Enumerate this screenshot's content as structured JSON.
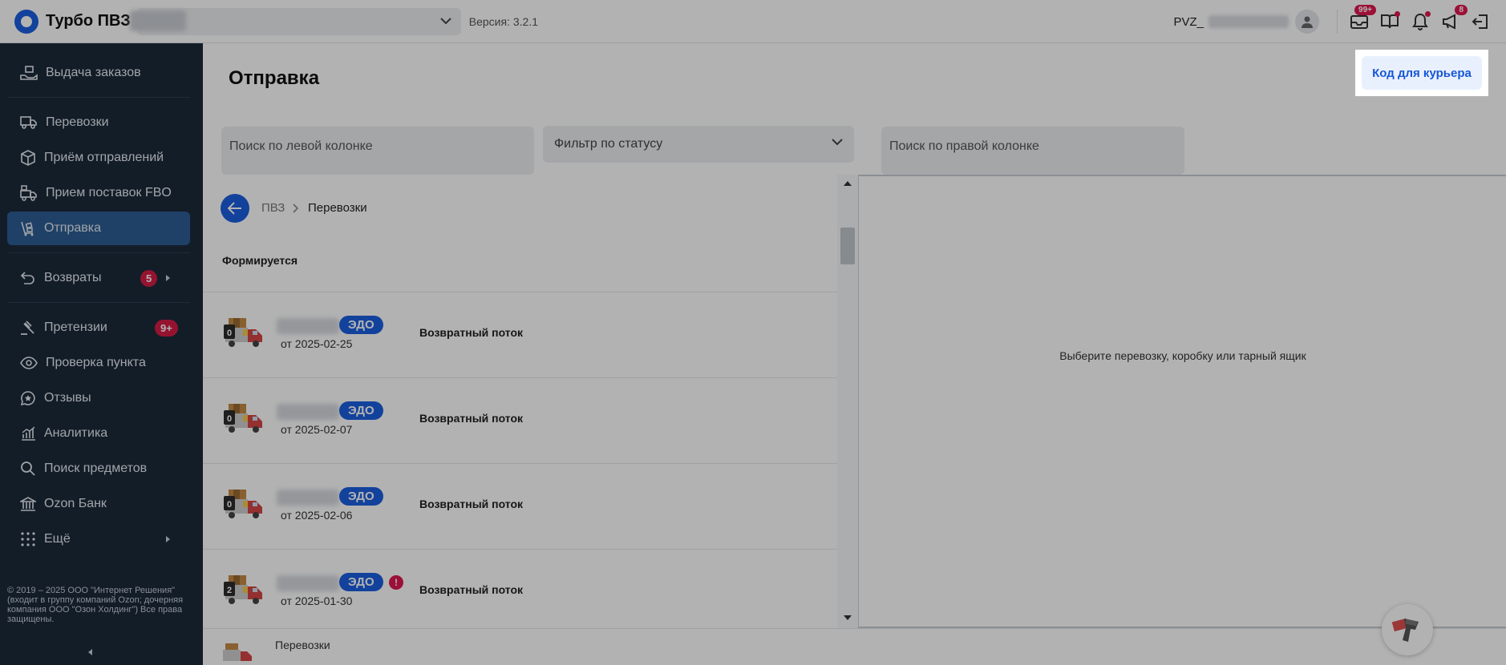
{
  "header": {
    "app_name": "Турбо ПВЗ",
    "version": "Версия: 3.2.1",
    "pvz_label": "PVZ_",
    "notifications": {
      "badge_main": "99+",
      "badge_megaphone": "8"
    }
  },
  "sidebar": {
    "items": [
      {
        "label": "Выдача заказов"
      },
      {
        "label": "Перевозки"
      },
      {
        "label": "Приём отправлений"
      },
      {
        "label": "Прием поставок FBO"
      },
      {
        "label": "Отправка"
      },
      {
        "label": "Возвраты",
        "badge": "5"
      },
      {
        "label": "Претензии",
        "badge": "9+"
      },
      {
        "label": "Проверка пункта"
      },
      {
        "label": "Отзывы"
      },
      {
        "label": "Аналитика"
      },
      {
        "label": "Поиск предметов"
      },
      {
        "label": "Ozon Банк"
      },
      {
        "label": "Ещё"
      }
    ],
    "copyright": "© 2019 – 2025 ООО \"Интернет Решения\" (входит в группу компаний Ozon; дочерняя компания ООО \"Озон Холдинг\") Все права защищены."
  },
  "main": {
    "title": "Отправка",
    "courier_button": "Код для курьера",
    "search_left_placeholder": "Поиск по левой колонке",
    "status_filter": "Фильтр по статусу",
    "search_right_placeholder": "Поиск по правой колонке",
    "breadcrumb": {
      "root": "ПВЗ",
      "current": "Перевозки"
    },
    "group_title": "Формируется",
    "rows": [
      {
        "badge": "ЭДО",
        "count": "0",
        "date": "от 2025-02-25",
        "flow": "Возвратный поток",
        "warning": false
      },
      {
        "badge": "ЭДО",
        "count": "0",
        "date": "от 2025-02-07",
        "flow": "Возвратный поток",
        "warning": false
      },
      {
        "badge": "ЭДО",
        "count": "0",
        "date": "от 2025-02-06",
        "flow": "Возвратный поток",
        "warning": false
      },
      {
        "badge": "ЭДО",
        "count": "2",
        "date": "от 2025-01-30",
        "flow": "Возвратный поток",
        "warning": true
      }
    ],
    "warning_mark": "!",
    "right_empty": "Выберите перевозку, коробку или тарный ящик",
    "bottom_label": "Перевозки"
  },
  "colors": {
    "accent": "#1a5fe0",
    "sidebar": "#1c2a3a",
    "badge": "#e0184f"
  }
}
